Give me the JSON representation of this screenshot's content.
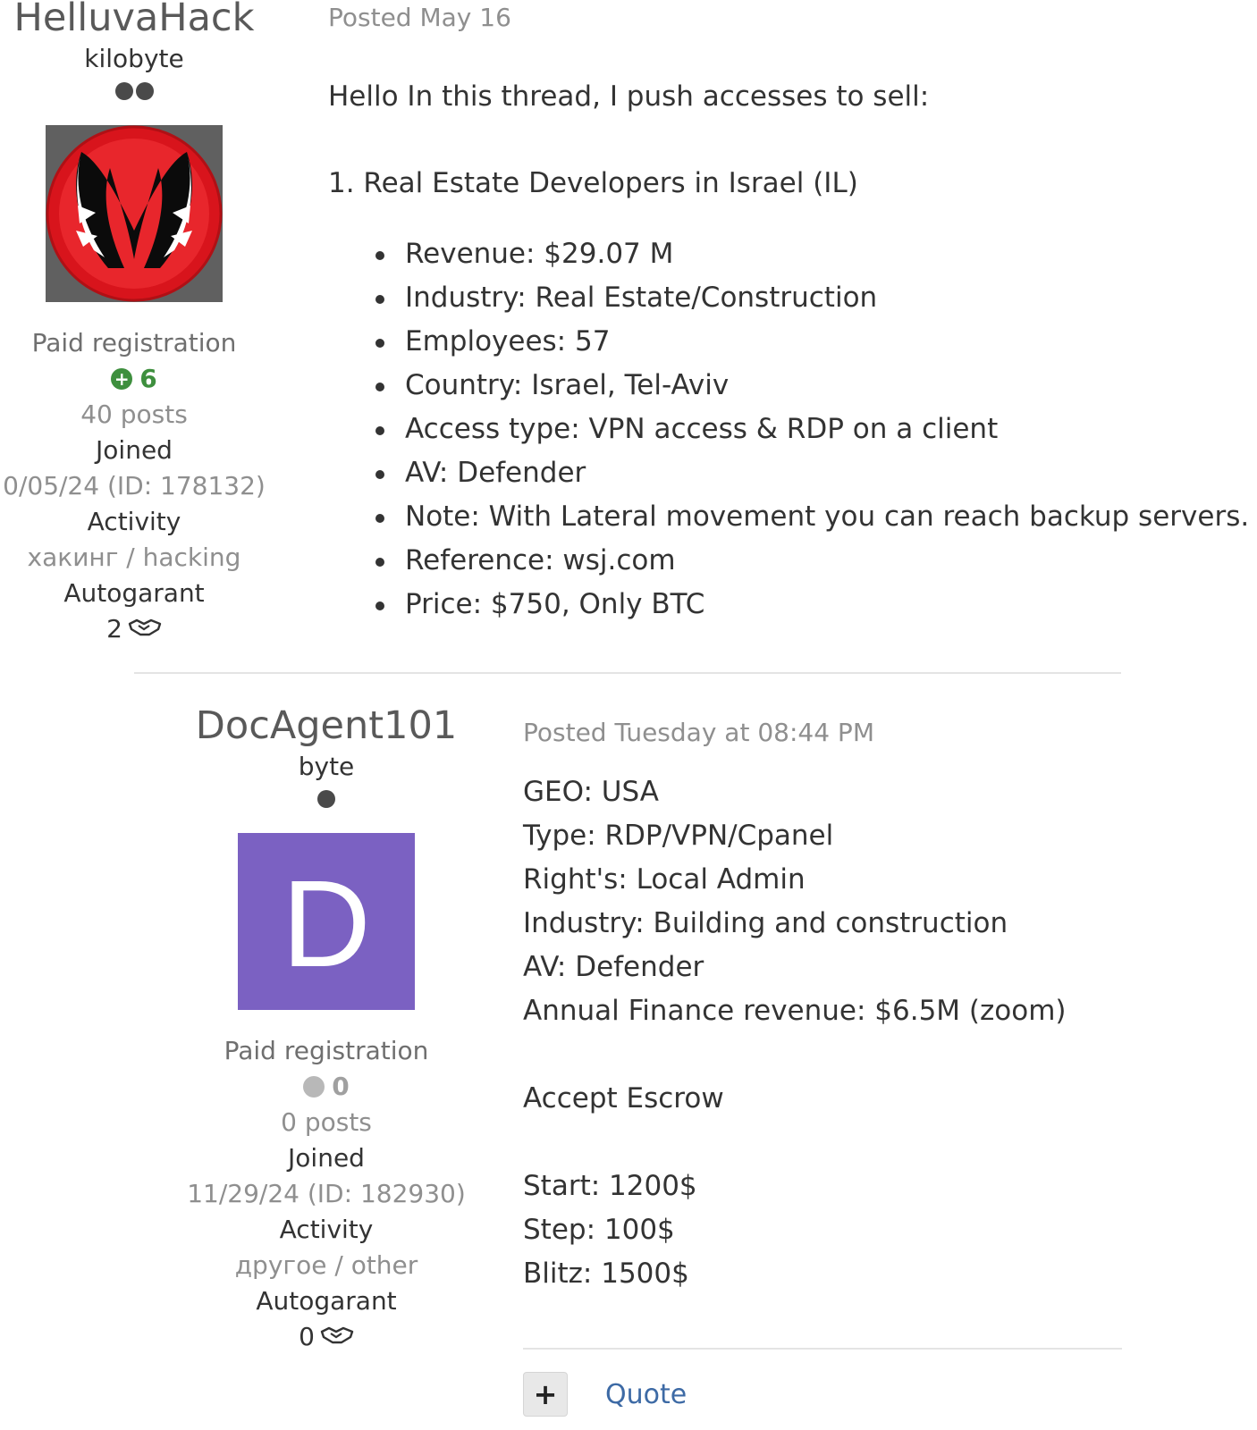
{
  "posts": [
    {
      "author": {
        "username": "HelluvaHack",
        "rank": "kilobyte",
        "registration": "Paid registration",
        "reputation": "6",
        "posts": "40 posts",
        "joined_label": "Joined",
        "joined_value": "0/05/24 (ID: 178132)",
        "activity_label": "Activity",
        "activity_value": "хакинг / hacking",
        "autogarant_label": "Autogarant",
        "autogarant_value": "2"
      },
      "posted": "Posted May 16",
      "intro": "Hello In this thread, I push accesses to sell:",
      "listing_title": "1. Real Estate Developers in Israel (IL)",
      "items": [
        "Revenue: $29.07 M",
        "Industry: Real Estate/Construction",
        "Employees: 57",
        "Country: Israel, Tel-Aviv",
        "Access type: VPN access & RDP on a client",
        "AV: Defender",
        "Note: With Lateral movement you can reach backup servers.",
        "Reference: wsj.com",
        "Price: $750, Only BTC"
      ]
    },
    {
      "author": {
        "username": "DocAgent101",
        "rank": "byte",
        "avatar_letter": "D",
        "avatar_color": "#7b61c2",
        "registration": "Paid registration",
        "reputation": "0",
        "posts": "0 posts",
        "joined_label": "Joined",
        "joined_value": "11/29/24 (ID: 182930)",
        "activity_label": "Activity",
        "activity_value": "другое / other",
        "autogarant_label": "Autogarant",
        "autogarant_value": "0"
      },
      "posted": "Posted Tuesday at 08:44 PM",
      "lines": [
        "GEO: USA",
        "Type: RDP/VPN/Cpanel",
        "Right's: Local Admin",
        "Industry: Building and construction",
        "AV: Defender",
        "Annual Finance revenue: $6.5M (zoom)"
      ],
      "escrow": "Accept Escrow",
      "auction": [
        "Start: 1200$",
        "Step: 100$",
        "Blitz: 1500$"
      ],
      "plus_label": "+",
      "quote_label": "Quote"
    }
  ],
  "colors": {
    "positive_rep": "#3e8f3e",
    "link": "#3d6aa5",
    "muted_text": "#8f8f8f"
  }
}
